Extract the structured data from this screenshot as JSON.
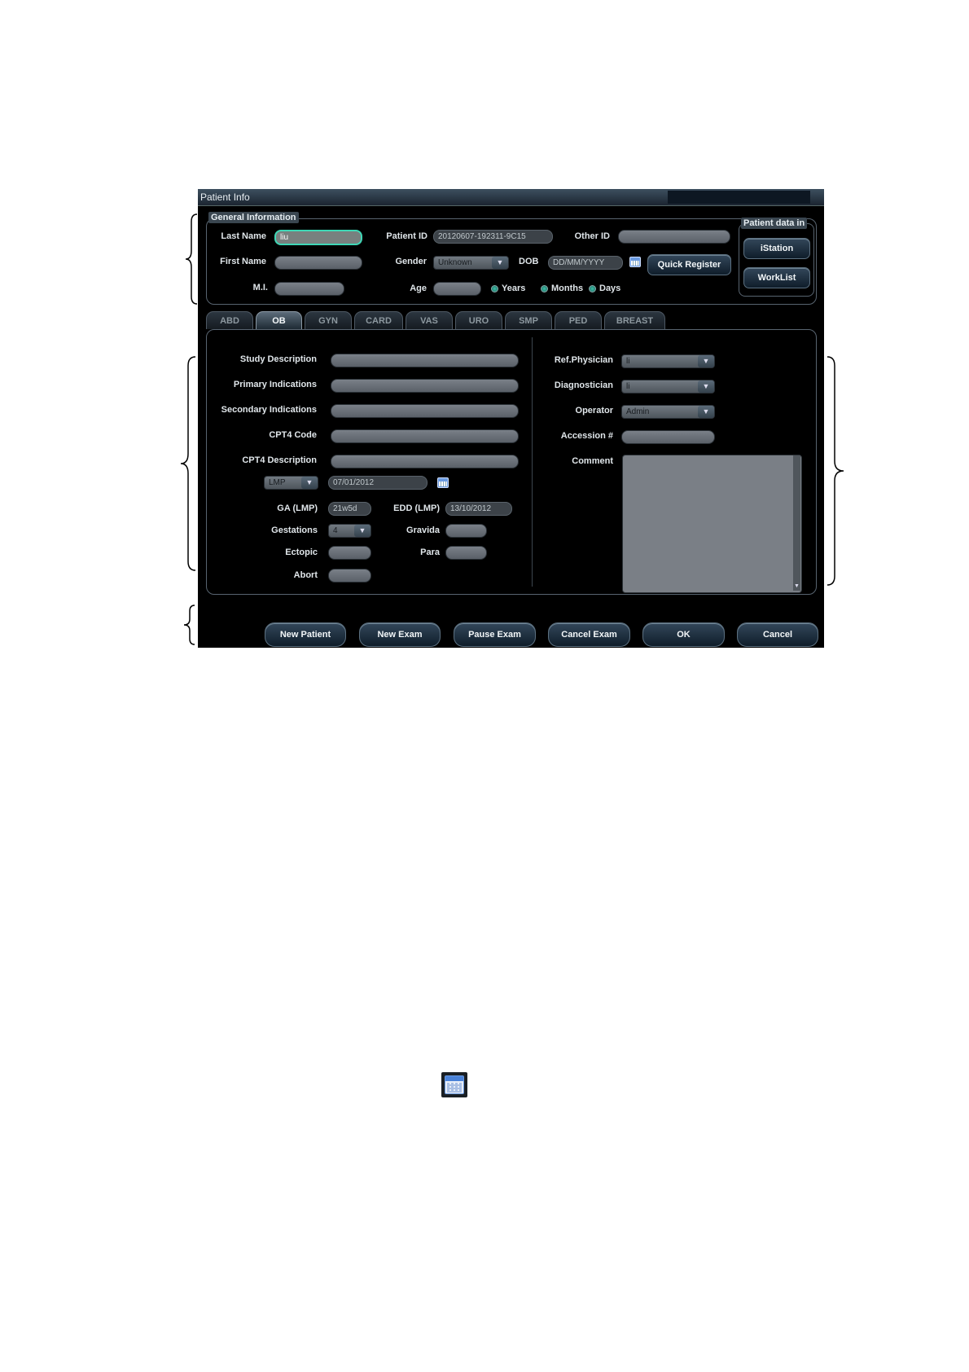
{
  "window": {
    "title": "Patient Info"
  },
  "general": {
    "legend": "General Information",
    "last_name_label": "Last Name",
    "last_name_value": "liu",
    "first_name_label": "First Name",
    "first_name_value": "",
    "mi_label": "M.I.",
    "mi_value": "",
    "patient_id_label": "Patient ID",
    "patient_id_value": "20120607-192311-9C15",
    "other_id_label": "Other ID",
    "other_id_value": "",
    "gender_label": "Gender",
    "gender_value": "Unknown",
    "dob_label": "DOB",
    "dob_placeholder": "DD/MM/YYYY",
    "age_label": "Age",
    "age_value": "",
    "age_units": [
      "Years",
      "Months",
      "Days"
    ],
    "quick_register": "Quick Register"
  },
  "patient_data_in": {
    "legend": "Patient data in",
    "istation": "iStation",
    "worklist": "WorkList"
  },
  "tabs": [
    "ABD",
    "OB",
    "GYN",
    "CARD",
    "VAS",
    "URO",
    "SMP",
    "PED",
    "BREAST"
  ],
  "active_tab": "OB",
  "exam": {
    "study_description": "Study Description",
    "primary_indications": "Primary Indications",
    "secondary_indications": "Secondary Indications",
    "cpt4_code": "CPT4 Code",
    "cpt4_description": "CPT4 Description",
    "lmp_select": "LMP",
    "lmp_date": "07/01/2012",
    "ga_label": "GA (LMP)",
    "ga_value": "21w5d",
    "edd_label": "EDD (LMP)",
    "edd_value": "13/10/2012",
    "gestations_label": "Gestations",
    "gestations_value": "4",
    "gravida_label": "Gravida",
    "ectopic_label": "Ectopic",
    "para_label": "Para",
    "abort_label": "Abort",
    "ref_physician_label": "Ref.Physician",
    "ref_physician_value": "li",
    "diagnostician_label": "Diagnostician",
    "diagnostician_value": "li",
    "operator_label": "Operator",
    "operator_value": "Admin",
    "accession_label": "Accession #",
    "comment_label": "Comment"
  },
  "buttons": [
    "New Patient",
    "New Exam",
    "Pause Exam",
    "Cancel Exam",
    "OK",
    "Cancel"
  ],
  "icons": {
    "calendar": "calendar-icon",
    "dropdown": "chevron-down-icon"
  },
  "colors": {
    "background": "#000000",
    "focus_border": "#3fd7b6",
    "radio": "#3cc0a8"
  }
}
